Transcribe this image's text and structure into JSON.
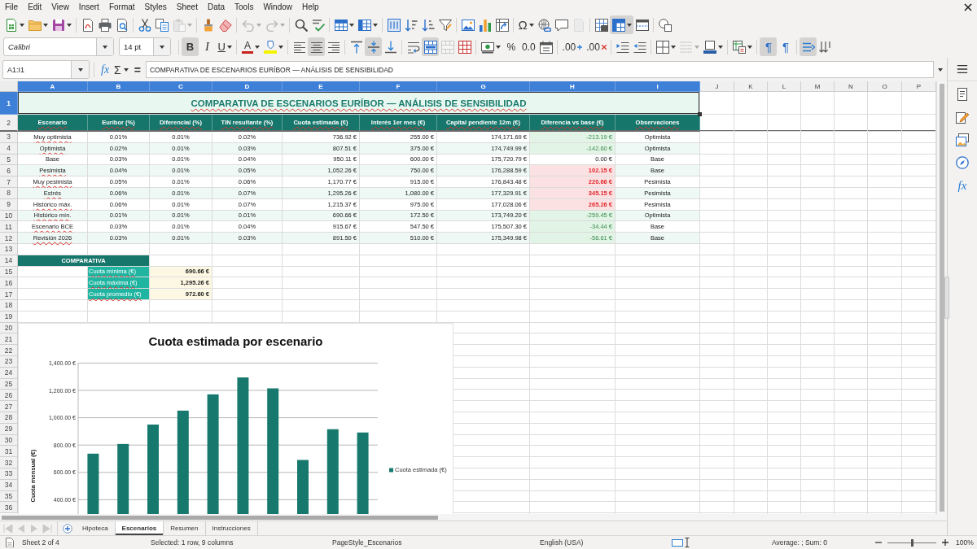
{
  "menu_bar": [
    "File",
    "Edit",
    "View",
    "Insert",
    "Format",
    "Styles",
    "Sheet",
    "Data",
    "Tools",
    "Window",
    "Help"
  ],
  "standard_toolbar": {
    "items": [
      {
        "pressed": false,
        "disabled": false
      },
      {
        "pressed": false,
        "disabled": false
      },
      {
        "pressed": false,
        "disabled": false
      },
      {
        "pressed": false,
        "disabled": false
      },
      {
        "pressed": false,
        "disabled": false
      },
      {
        "pressed": false,
        "disabled": false
      },
      {
        "pressed": false,
        "disabled": false
      },
      {
        "pressed": false,
        "disabled": false
      },
      {
        "pressed": false,
        "disabled": true
      },
      {
        "pressed": false,
        "disabled": false
      },
      {
        "pressed": false,
        "disabled": false
      },
      {
        "pressed": false,
        "disabled": true
      },
      {
        "pressed": false,
        "disabled": true
      },
      {
        "pressed": false,
        "disabled": false
      },
      {
        "pressed": false,
        "disabled": false
      },
      {
        "pressed": false,
        "disabled": false
      },
      {
        "pressed": false,
        "disabled": false
      },
      {
        "pressed": false,
        "disabled": false
      },
      {
        "pressed": false,
        "disabled": false
      },
      {
        "pressed": false,
        "disabled": false
      },
      {
        "pressed": false,
        "disabled": false
      },
      {
        "pressed": false,
        "disabled": false
      },
      {
        "pressed": false,
        "disabled": false
      },
      {
        "pressed": false,
        "disabled": false
      },
      {
        "label": "Ω",
        "pressed": false,
        "disabled": false
      },
      {
        "pressed": false,
        "disabled": false
      },
      {
        "pressed": false,
        "disabled": false
      },
      {
        "pressed": false,
        "disabled": true
      },
      {
        "pressed": false,
        "disabled": false
      },
      {
        "pressed": true,
        "disabled": false
      },
      {
        "pressed": false,
        "disabled": false
      },
      {
        "pressed": false,
        "disabled": false
      }
    ]
  },
  "format_toolbar": {
    "font_name": "Calibri",
    "font_size": "14 pt",
    "items": [
      {
        "label": "B",
        "pressed": true,
        "disabled": false
      },
      {
        "label": "I",
        "pressed": false,
        "disabled": false
      },
      {
        "label": "U",
        "pressed": false,
        "disabled": false
      },
      {
        "label": "A",
        "pressed": false,
        "disabled": false
      },
      {
        "pressed": false,
        "disabled": false
      },
      {
        "pressed": false,
        "disabled": false
      },
      {
        "pressed": true,
        "disabled": false
      },
      {
        "pressed": false,
        "disabled": false
      },
      {
        "pressed": false,
        "disabled": false
      },
      {
        "pressed": true,
        "disabled": false
      },
      {
        "pressed": false,
        "disabled": false
      },
      {
        "pressed": false,
        "disabled": false
      },
      {
        "pressed": true,
        "disabled": false
      },
      {
        "pressed": false,
        "disabled": true
      },
      {
        "pressed": false,
        "disabled": false
      },
      {
        "pressed": false,
        "disabled": false
      },
      {
        "label": "%",
        "pressed": false,
        "disabled": false
      },
      {
        "label": "0.0",
        "pressed": false,
        "disabled": false
      },
      {
        "pressed": false,
        "disabled": false
      },
      {
        "label": ".00",
        "pressed": false,
        "disabled": false
      },
      {
        "label": ".00",
        "pressed": false,
        "disabled": false
      },
      {
        "pressed": false,
        "disabled": false
      },
      {
        "pressed": false,
        "disabled": false
      },
      {
        "pressed": false,
        "disabled": false
      },
      {
        "pressed": false,
        "disabled": true
      },
      {
        "pressed": false,
        "disabled": false
      },
      {
        "pressed": false,
        "disabled": false
      },
      {
        "label": "¶",
        "pressed": true,
        "disabled": false
      },
      {
        "label": "¶",
        "pressed": false,
        "disabled": false
      },
      {
        "pressed": true,
        "disabled": false
      },
      {
        "pressed": false,
        "disabled": false
      }
    ]
  },
  "formula_bar": {
    "name_box": "A1:I1",
    "function_wizard": "fx",
    "sum": "Σ",
    "formula_sign": "=",
    "formula": "COMPARATIVA DE ESCENARIOS EURÍBOR — ANÁLISIS DE SENSIBILIDAD"
  },
  "sheet": {
    "columns": [
      {
        "label": "A",
        "selected": true
      },
      {
        "label": "B",
        "selected": true
      },
      {
        "label": "C",
        "selected": true
      },
      {
        "label": "D",
        "selected": true
      },
      {
        "label": "E",
        "selected": true
      },
      {
        "label": "F",
        "selected": true
      },
      {
        "label": "G",
        "selected": true
      },
      {
        "label": "H",
        "selected": true
      },
      {
        "label": "I",
        "selected": true
      },
      {
        "label": "J",
        "selected": false
      },
      {
        "label": "K",
        "selected": false
      },
      {
        "label": "L",
        "selected": false
      },
      {
        "label": "M",
        "selected": false
      },
      {
        "label": "N",
        "selected": false
      },
      {
        "label": "O",
        "selected": false
      },
      {
        "label": "P",
        "selected": false
      }
    ],
    "rows": [
      {
        "label": "1",
        "selected": true
      },
      {
        "label": "2",
        "selected": false
      },
      {
        "label": "3",
        "selected": false
      },
      {
        "label": "4",
        "selected": false
      },
      {
        "label": "5",
        "selected": false
      },
      {
        "label": "6",
        "selected": false
      },
      {
        "label": "7",
        "selected": false
      },
      {
        "label": "8",
        "selected": false
      },
      {
        "label": "9",
        "selected": false
      },
      {
        "label": "10",
        "selected": false
      },
      {
        "label": "11",
        "selected": false
      },
      {
        "label": "12",
        "selected": false
      },
      {
        "label": "13",
        "selected": false
      },
      {
        "label": "14",
        "selected": false
      },
      {
        "label": "15",
        "selected": false
      },
      {
        "label": "16",
        "selected": false
      },
      {
        "label": "17",
        "selected": false
      },
      {
        "label": "18",
        "selected": false
      },
      {
        "label": "19",
        "selected": false
      },
      {
        "label": "20",
        "selected": false
      },
      {
        "label": "21",
        "selected": false
      },
      {
        "label": "22",
        "selected": false
      },
      {
        "label": "23",
        "selected": false
      },
      {
        "label": "24",
        "selected": false
      },
      {
        "label": "25",
        "selected": false
      },
      {
        "label": "26",
        "selected": false
      },
      {
        "label": "27",
        "selected": false
      },
      {
        "label": "28",
        "selected": false
      },
      {
        "label": "29",
        "selected": false
      },
      {
        "label": "30",
        "selected": false
      },
      {
        "label": "31",
        "selected": false
      },
      {
        "label": "32",
        "selected": false
      },
      {
        "label": "33",
        "selected": false
      },
      {
        "label": "34",
        "selected": false
      },
      {
        "label": "35",
        "selected": false
      },
      {
        "label": "36",
        "selected": false
      }
    ],
    "title": {
      "text": "COMPARATIVA DE ESCENARIOS EURÍBOR — ANÁLISIS DE SENSIBILIDAD",
      "misspelled": true
    },
    "table": {
      "columns": [
        {
          "label": "Escenario",
          "misspelled": true
        },
        {
          "label": "Euríbor (%)",
          "misspelled": true
        },
        {
          "label": "Diferencial (%)",
          "misspelled": true
        },
        {
          "label": "TIN resultante (%)",
          "misspelled": true
        },
        {
          "label": "Cuota estimada (€)",
          "misspelled": true
        },
        {
          "label": "Interés 1er mes (€)",
          "misspelled": true
        },
        {
          "label": "Capital pendiente 12m (€)",
          "misspelled": true
        },
        {
          "label": "Diferencia vs base (€)",
          "misspelled": true
        },
        {
          "label": "Observaciones",
          "misspelled": true
        }
      ],
      "rows": [
        {
          "cells": [
            "Muy optimista",
            "0.01%",
            "0.01%",
            "0.02%",
            "736.92 €",
            "255.00 €",
            "174,171.69 €",
            "-213.19 €",
            "Optimista"
          ],
          "misspelled": true,
          "kind": "lower"
        },
        {
          "cells": [
            "Optimista",
            "0.02%",
            "0.01%",
            "0.03%",
            "807.51 €",
            "375.00 €",
            "174,749.99 €",
            "-142.60 €",
            "Optimista"
          ],
          "misspelled": true,
          "kind": "lower"
        },
        {
          "cells": [
            "Base",
            "0.03%",
            "0.01%",
            "0.04%",
            "950.11 €",
            "600.00 €",
            "175,720.79 €",
            "0.00 €",
            "Base"
          ],
          "misspelled": false,
          "kind": "equal"
        },
        {
          "cells": [
            "Pesimista",
            "0.04%",
            "0.01%",
            "0.05%",
            "1,052.26 €",
            "750.00 €",
            "176,288.59 €",
            "102.15 €",
            "Base"
          ],
          "misspelled": true,
          "kind": "higher"
        },
        {
          "cells": [
            "Muy pesimista",
            "0.05%",
            "0.01%",
            "0.06%",
            "1,170.77 €",
            "915.00 €",
            "176,843.48 €",
            "220.66 €",
            "Pesimista"
          ],
          "misspelled": true,
          "kind": "higher"
        },
        {
          "cells": [
            "Estrés",
            "0.06%",
            "0.01%",
            "0.07%",
            "1,295.26 €",
            "1,080.00 €",
            "177,329.91 €",
            "345.15 €",
            "Pesimista"
          ],
          "misspelled": true,
          "kind": "higher"
        },
        {
          "cells": [
            "Histórico máx.",
            "0.06%",
            "0.01%",
            "0.07%",
            "1,215.37 €",
            "975.00 €",
            "177,028.06 €",
            "265.26 €",
            "Pesimista"
          ],
          "misspelled": true,
          "kind": "higher"
        },
        {
          "cells": [
            "Histórico mín.",
            "0.01%",
            "0.01%",
            "0.01%",
            "690.66 €",
            "172.50 €",
            "173,749.20 €",
            "-259.45 €",
            "Optimista"
          ],
          "misspelled": true,
          "kind": "lower"
        },
        {
          "cells": [
            "Escenario BCE",
            "0.03%",
            "0.01%",
            "0.04%",
            "915.67 €",
            "547.50 €",
            "175,507.30 €",
            "-34.44 €",
            "Base"
          ],
          "misspelled": true,
          "kind": "lower"
        },
        {
          "cells": [
            "Revisión 2026",
            "0.03%",
            "0.01%",
            "0.03%",
            "891.50 €",
            "510.00 €",
            "175,349.98 €",
            "-58.61 €",
            "Base"
          ],
          "misspelled": true,
          "kind": "lower"
        }
      ]
    },
    "summary": {
      "heading": "COMPARATIVA",
      "items": [
        {
          "label": "Cuota mínima (€)",
          "value": "690.66 €",
          "misspelled": true
        },
        {
          "label": "Cuota máxima (€)",
          "value": "1,295.26 €",
          "misspelled": true
        },
        {
          "label": "Cuota promedio (€)",
          "value": "972.60 €",
          "misspelled": true
        }
      ]
    },
    "chart": {
      "chart_data": {
        "type": "bar",
        "title": "Cuota estimada por escenario",
        "ylabel": "Cuota mensual (€)",
        "series": [
          {
            "name": "Cuota estimada (€)",
            "color": "#17796d",
            "values": [
              737,
              808,
              950,
              1052,
              1171,
              1295,
              1215,
              691,
              916,
              892
            ]
          }
        ],
        "ylim": [
          293,
          1400
        ],
        "yticks": [
          {
            "value": 400,
            "label": "400.00 €"
          },
          {
            "value": 600,
            "label": "600.00 €"
          },
          {
            "value": 800,
            "label": "800.00 €"
          },
          {
            "value": 1000,
            "label": "1,000.00 €"
          },
          {
            "value": 1200,
            "label": "1,200.00 €"
          },
          {
            "value": 1400,
            "label": "1,400.00 €"
          }
        ],
        "grid": true
      }
    }
  },
  "sheet_navigation": [
    {
      "disabled": true
    },
    {
      "disabled": true
    },
    {
      "disabled": true
    },
    {
      "disabled": true
    }
  ],
  "sheet_tabs": [
    {
      "label": "Hipoteca",
      "selected": false
    },
    {
      "label": "Escenarios",
      "selected": true
    },
    {
      "label": "Resumen",
      "selected": false
    },
    {
      "label": "Instrucciones",
      "selected": false
    }
  ],
  "sidebar": {
    "function_tab": "fx"
  },
  "status_bar": {
    "sheet_position": "Sheet 2 of 4",
    "selection": "Selected: 1 row, 9 columns",
    "page_style": "PageStyle_Escenarios",
    "language": "English (USA)",
    "summary": "Average: ; Sum: 0",
    "zoom": {
      "level": 0.5,
      "reading": "100%"
    }
  }
}
